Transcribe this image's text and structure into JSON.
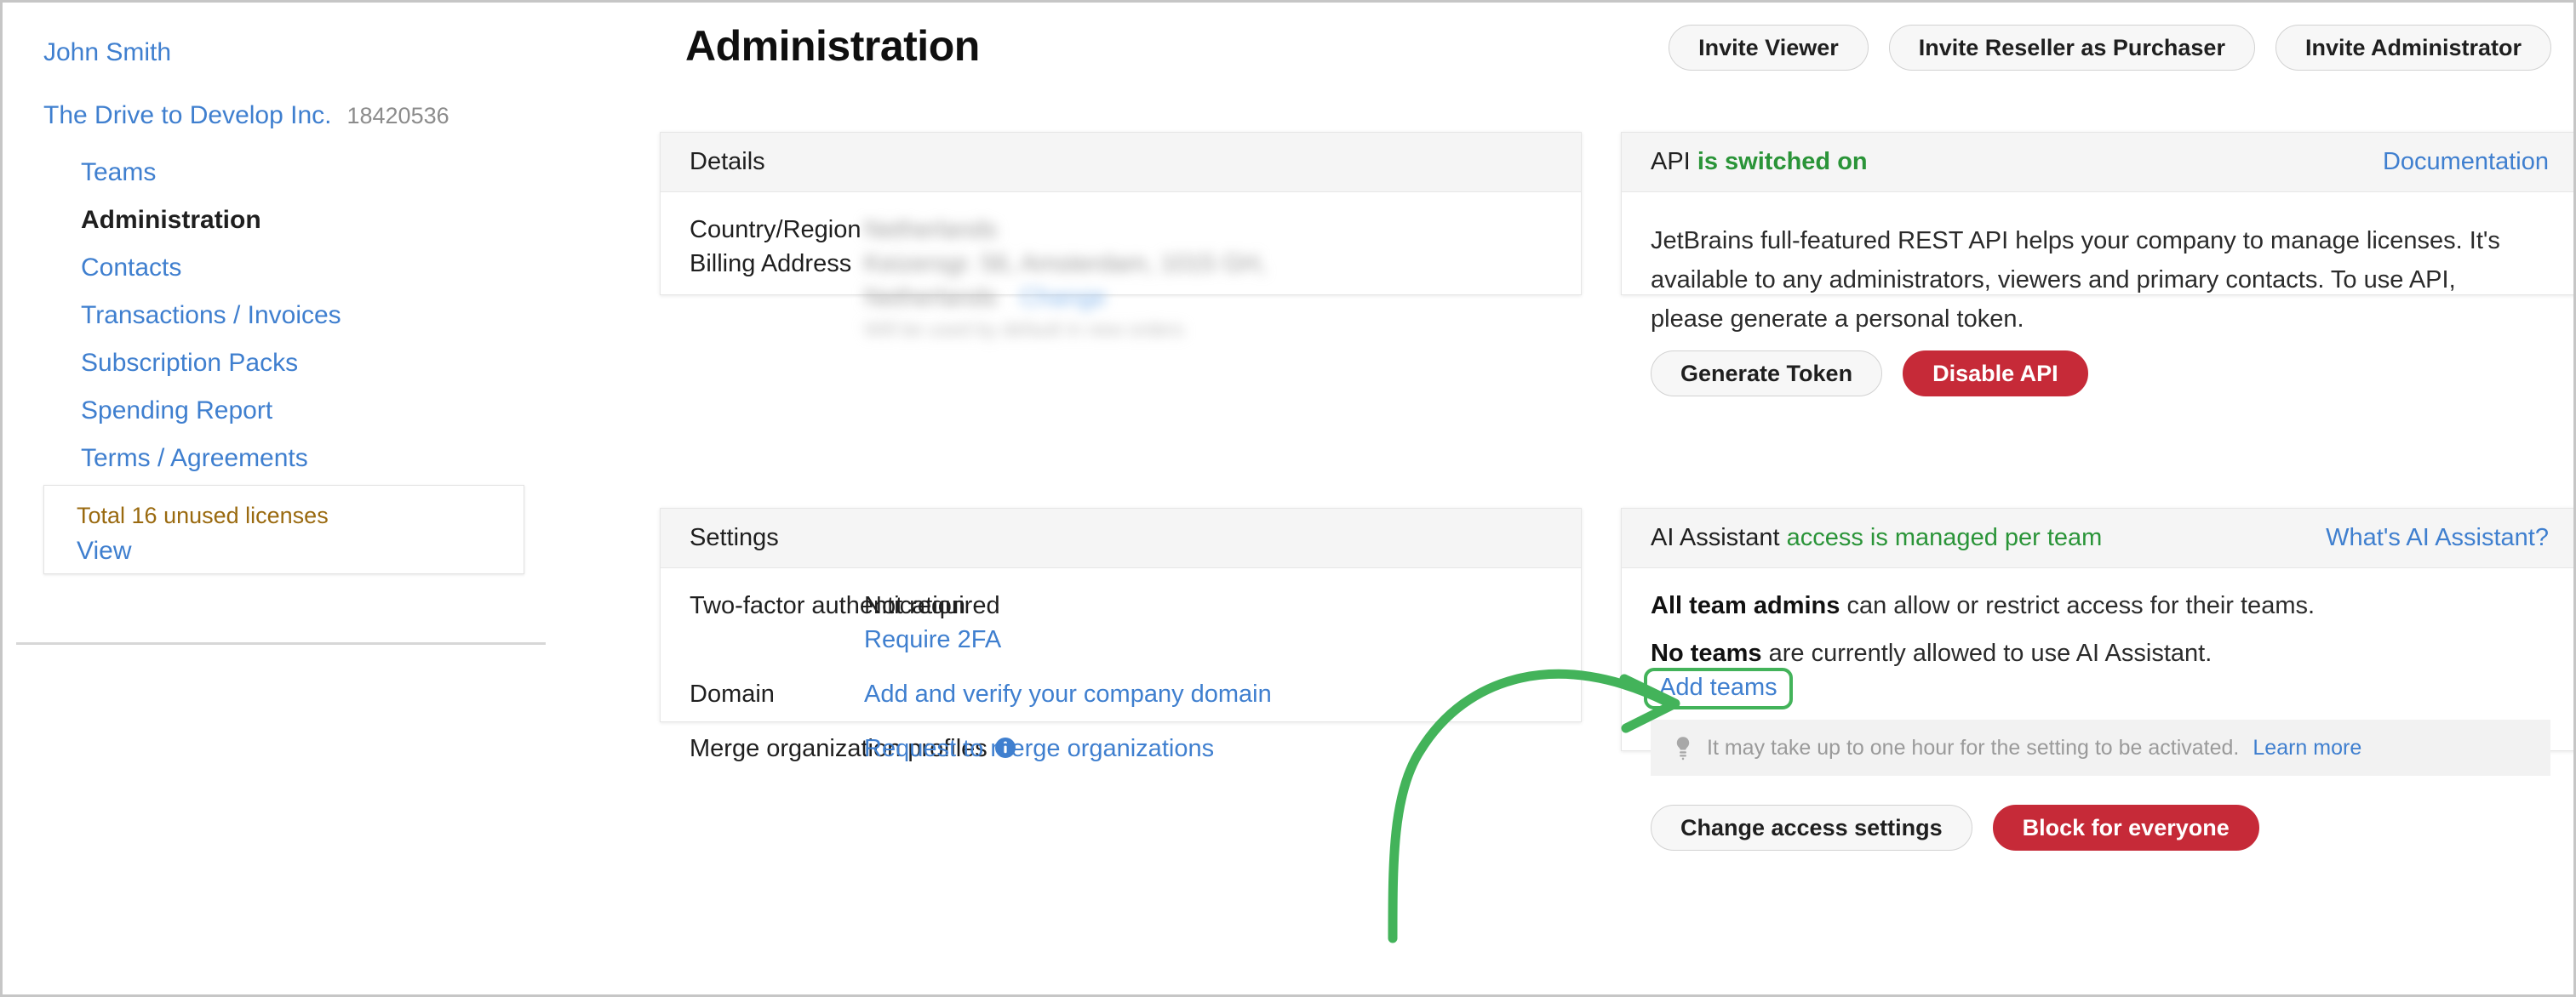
{
  "sidebar": {
    "user_name": "John Smith",
    "organization": "The Drive to Develop Inc.",
    "organization_id": "18420536",
    "nav_items": [
      {
        "label": "Teams",
        "current": false
      },
      {
        "label": "Administration",
        "current": true
      },
      {
        "label": "Contacts",
        "current": false
      },
      {
        "label": "Transactions / Invoices",
        "current": false
      },
      {
        "label": "Subscription Packs",
        "current": false
      },
      {
        "label": "Spending Report",
        "current": false
      },
      {
        "label": "Terms / Agreements",
        "current": false
      }
    ],
    "license_box": {
      "summary": "Total 16 unused licenses",
      "view_label": "View"
    }
  },
  "header": {
    "title": "Administration",
    "buttons": [
      {
        "label": "Invite Viewer"
      },
      {
        "label": "Invite Reseller as Purchaser"
      },
      {
        "label": "Invite Administrator"
      }
    ]
  },
  "details_card": {
    "title": "Details",
    "country_label": "Country/Region",
    "country_value": "Netherlands",
    "billing_label": "Billing Address",
    "billing_line1": "Keizersgr. 56, Amsterdam, 1015 GH,",
    "billing_line2": "Netherlands",
    "billing_change_label": "Change",
    "billing_note": "Will be used by default in new orders"
  },
  "settings_card": {
    "title": "Settings",
    "rows": [
      {
        "label": "Two-factor authentication",
        "value": "Not required",
        "link": "Require 2FA"
      },
      {
        "label": "Domain",
        "value": "",
        "link": "Add and verify your company domain"
      },
      {
        "label": "Merge organization profiles",
        "value": "",
        "link": "Request to merge organizations",
        "has_info_icon": true
      }
    ]
  },
  "api_card": {
    "title_prefix": "API",
    "status": "is switched on",
    "doc_link": "Documentation",
    "description": "JetBrains full-featured REST API helps your company to manage licenses. It's available to any administrators, viewers and primary contacts. To use API, please generate a personal token.",
    "generate_button": "Generate Token",
    "disable_button": "Disable API"
  },
  "ai_card": {
    "title_prefix": "AI Assistant",
    "status": "access is managed per team",
    "help_link": "What's AI Assistant?",
    "line1_bold": "All team admins",
    "line1_rest": " can allow or restrict access for their teams.",
    "line2_bold": "No teams",
    "line2_rest": " are currently allowed to use AI Assistant.",
    "add_teams_link": "Add teams",
    "note_text": "It may take up to one hour for the setting to be activated.",
    "note_link": "Learn more",
    "change_button": "Change access settings",
    "block_button": "Block for everyone"
  },
  "annotation": {
    "type": "curved-arrow",
    "color": "#43b35a",
    "points_at": "Add teams"
  },
  "colors": {
    "link": "#3f7fcf",
    "status_green": "#2a9438",
    "danger": "#c62a38",
    "license_amber": "#9a6a10",
    "annotation_green": "#43b35a",
    "card_header_bg": "#f5f5f5"
  }
}
